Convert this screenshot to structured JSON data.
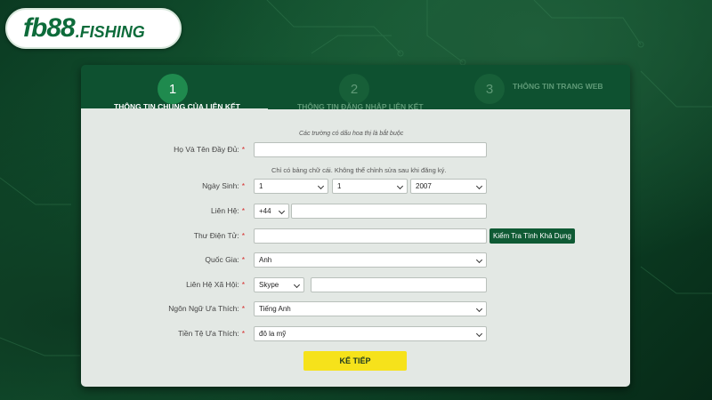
{
  "logo": {
    "main": "fb88",
    "suffix": ".FISHING"
  },
  "steps": [
    {
      "number": "1",
      "label": "Thông tin chung của liên kết"
    },
    {
      "number": "2",
      "label": "Thông tin đăng nhập liên kết"
    },
    {
      "number": "3",
      "label": "Thông tin trang web"
    }
  ],
  "form": {
    "required_note": "Các trường có dấu hoa thị là bắt buộc",
    "name_note": "Chỉ có bảng chữ cái. Không thể chỉnh sửa sau khi đăng ký.",
    "required_mark": "*",
    "fields": {
      "full_name": {
        "label": "Họ Và Tên Đầy Đủ:",
        "value": ""
      },
      "birth": {
        "label": "Ngày Sinh:",
        "day": "1",
        "month": "1",
        "year": "2007"
      },
      "contact": {
        "label": "Liên Hệ:",
        "code": "+44",
        "value": ""
      },
      "email": {
        "label": "Thư Điện Tử:",
        "value": "",
        "check_button": "Kiểm Tra Tính Khả Dụng"
      },
      "country": {
        "label": "Quốc Gia:",
        "value": "Anh"
      },
      "social": {
        "label": "Liên Hệ Xã Hội:",
        "type": "Skype",
        "value": ""
      },
      "language": {
        "label": "Ngôn Ngữ Ưa Thích:",
        "value": "Tiếng Anh"
      },
      "currency": {
        "label": "Tiền Tệ Ưa Thích:",
        "value": "đô la mỹ"
      }
    },
    "next_button": "Kế tiếp"
  }
}
